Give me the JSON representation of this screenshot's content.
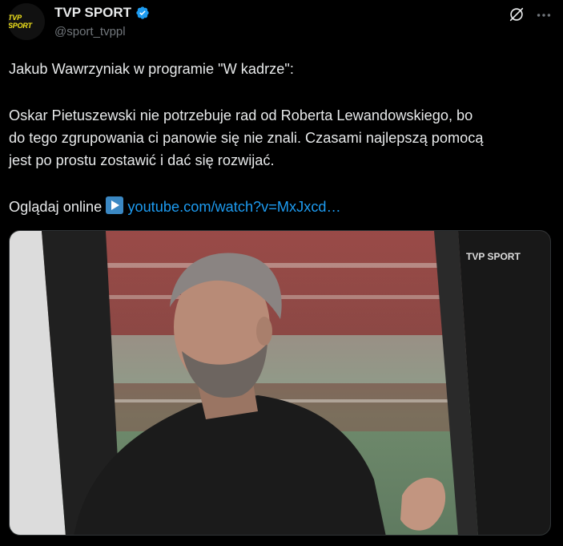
{
  "author": {
    "display_name": "TVP SPORT",
    "handle": "@sport_tvppl",
    "avatar_text": "TVP SPORT"
  },
  "tweet": {
    "line1": "Jakub Wawrzyniak w programie \"W kadrze\":",
    "para2_line1": "Oskar Pietuszewski nie potrzebuje rad od Roberta Lewandowskiego, bo",
    "para2_line2": "do tego zgrupowania ci panowie się nie znali. Czasami najlepszą pomocą",
    "para2_line3": "jest po prostu zostawić i dać się rozwijać.",
    "watch_label": "Oglądaj online",
    "link_text": "youtube.com/watch?v=MxJxcd…"
  },
  "media": {
    "watermark": "TVP SPORT"
  },
  "icons": {
    "verified": "verified-badge-icon",
    "grok": "grok-icon",
    "more": "more-icon",
    "play": "play-button-emoji-icon"
  },
  "colors": {
    "background": "#000000",
    "text": "#e7e9ea",
    "secondary": "#71767b",
    "link": "#1d9bf0",
    "verified": "#1d9bf0"
  }
}
